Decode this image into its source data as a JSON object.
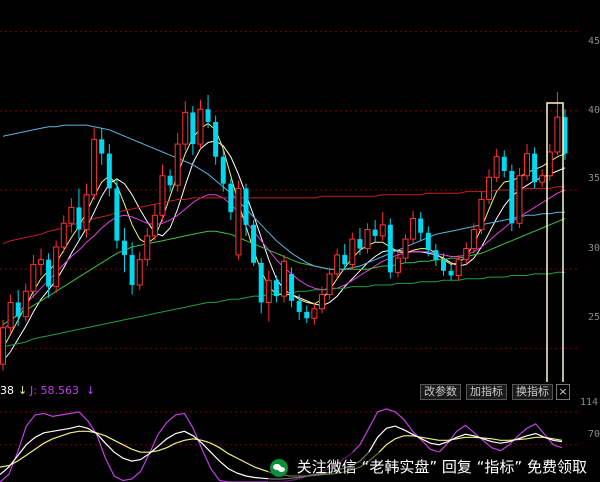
{
  "colors": {
    "up": "#ff3232",
    "down": "#00d8f0",
    "grid": "#8b0000",
    "ma_white": "#ffffff",
    "ma_yellow": "#f0f080",
    "ma_magenta": "#e040e0",
    "ma_lightgreen": "#40c040",
    "ma_skyblue": "#5ab4e0",
    "ma_darkred": "#c02020",
    "ma_green": "#20a040",
    "k_line": "#ffffff",
    "d_line": "#f0f080",
    "j_line": "#c040e0"
  },
  "indicator": {
    "left_value": "38",
    "left_arrow": "↓",
    "j_label": "J: 58.563",
    "j_arrow": "↓",
    "buttons": [
      "改参数",
      "加指标",
      "换指标"
    ],
    "close": "×"
  },
  "axis": {
    "main_ticks": [
      "45",
      "40",
      "35",
      "30",
      "25"
    ],
    "sub_ticks": [
      "114",
      "70"
    ]
  },
  "watermark": {
    "text": "关注微信 “老韩实盘” 回复 “指标” 免费领取"
  },
  "chart_data": {
    "type": "candlestick",
    "price_range": [
      23,
      47
    ],
    "grid": true,
    "candles": [
      {
        "o": 24.0,
        "h": 26.8,
        "l": 23.6,
        "c": 26.3
      },
      {
        "o": 26.3,
        "h": 28.4,
        "l": 25.9,
        "c": 27.9
      },
      {
        "o": 27.9,
        "h": 28.7,
        "l": 26.4,
        "c": 27.0
      },
      {
        "o": 27.0,
        "h": 29.1,
        "l": 26.7,
        "c": 28.6
      },
      {
        "o": 28.6,
        "h": 30.9,
        "l": 28.2,
        "c": 30.3
      },
      {
        "o": 30.3,
        "h": 31.3,
        "l": 29.6,
        "c": 30.6
      },
      {
        "o": 30.6,
        "h": 31.0,
        "l": 28.2,
        "c": 28.9
      },
      {
        "o": 28.9,
        "h": 31.8,
        "l": 28.5,
        "c": 31.4
      },
      {
        "o": 31.4,
        "h": 33.4,
        "l": 31.0,
        "c": 32.9
      },
      {
        "o": 32.9,
        "h": 34.5,
        "l": 32.3,
        "c": 33.9
      },
      {
        "o": 33.9,
        "h": 35.1,
        "l": 31.9,
        "c": 32.5
      },
      {
        "o": 32.5,
        "h": 35.4,
        "l": 32.0,
        "c": 34.7
      },
      {
        "o": 34.7,
        "h": 38.9,
        "l": 34.4,
        "c": 38.2
      },
      {
        "o": 38.2,
        "h": 38.9,
        "l": 36.6,
        "c": 37.3
      },
      {
        "o": 37.3,
        "h": 37.9,
        "l": 34.6,
        "c": 35.1
      },
      {
        "o": 35.1,
        "h": 35.7,
        "l": 31.3,
        "c": 31.8
      },
      {
        "o": 31.8,
        "h": 32.6,
        "l": 29.8,
        "c": 30.9
      },
      {
        "o": 30.9,
        "h": 31.7,
        "l": 28.4,
        "c": 29.0
      },
      {
        "o": 29.0,
        "h": 31.1,
        "l": 28.7,
        "c": 30.6
      },
      {
        "o": 30.6,
        "h": 32.6,
        "l": 30.2,
        "c": 32.1
      },
      {
        "o": 32.1,
        "h": 34.1,
        "l": 31.8,
        "c": 33.4
      },
      {
        "o": 33.4,
        "h": 36.6,
        "l": 33.0,
        "c": 35.9
      },
      {
        "o": 35.9,
        "h": 36.3,
        "l": 34.9,
        "c": 35.3
      },
      {
        "o": 35.3,
        "h": 38.6,
        "l": 34.9,
        "c": 37.9
      },
      {
        "o": 37.9,
        "h": 40.6,
        "l": 37.5,
        "c": 39.9
      },
      {
        "o": 39.9,
        "h": 40.3,
        "l": 37.2,
        "c": 37.9
      },
      {
        "o": 37.9,
        "h": 40.7,
        "l": 37.6,
        "c": 40.1
      },
      {
        "o": 40.1,
        "h": 41.0,
        "l": 38.9,
        "c": 39.3
      },
      {
        "o": 39.3,
        "h": 39.7,
        "l": 36.6,
        "c": 37.1
      },
      {
        "o": 37.1,
        "h": 37.6,
        "l": 34.9,
        "c": 35.4
      },
      {
        "o": 35.4,
        "h": 35.7,
        "l": 33.1,
        "c": 33.6
      },
      {
        "o": 30.9,
        "h": 35.6,
        "l": 30.6,
        "c": 35.1
      },
      {
        "o": 35.1,
        "h": 35.4,
        "l": 32.1,
        "c": 32.8
      },
      {
        "o": 32.8,
        "h": 33.1,
        "l": 30.2,
        "c": 30.4
      },
      {
        "o": 30.4,
        "h": 30.7,
        "l": 27.2,
        "c": 27.9
      },
      {
        "o": 27.9,
        "h": 29.9,
        "l": 26.7,
        "c": 29.3
      },
      {
        "o": 29.3,
        "h": 29.6,
        "l": 27.9,
        "c": 28.3
      },
      {
        "o": 28.3,
        "h": 30.9,
        "l": 27.9,
        "c": 30.5
      },
      {
        "o": 29.7,
        "h": 30.1,
        "l": 27.6,
        "c": 28.0
      },
      {
        "o": 28.0,
        "h": 28.4,
        "l": 26.8,
        "c": 27.3
      },
      {
        "o": 27.3,
        "h": 27.7,
        "l": 26.6,
        "c": 26.9
      },
      {
        "o": 26.9,
        "h": 27.9,
        "l": 26.5,
        "c": 27.5
      },
      {
        "o": 27.5,
        "h": 28.9,
        "l": 27.2,
        "c": 28.4
      },
      {
        "o": 28.4,
        "h": 30.1,
        "l": 28.1,
        "c": 29.7
      },
      {
        "o": 29.7,
        "h": 31.3,
        "l": 29.4,
        "c": 30.9
      },
      {
        "o": 30.9,
        "h": 31.6,
        "l": 30.0,
        "c": 30.3
      },
      {
        "o": 30.3,
        "h": 32.3,
        "l": 30.0,
        "c": 31.9
      },
      {
        "o": 31.9,
        "h": 32.6,
        "l": 30.9,
        "c": 31.3
      },
      {
        "o": 31.3,
        "h": 32.9,
        "l": 31.0,
        "c": 32.5
      },
      {
        "o": 32.5,
        "h": 33.1,
        "l": 31.7,
        "c": 32.1
      },
      {
        "o": 32.1,
        "h": 33.6,
        "l": 31.8,
        "c": 32.8
      },
      {
        "o": 32.8,
        "h": 33.2,
        "l": 29.4,
        "c": 29.8
      },
      {
        "o": 29.8,
        "h": 31.1,
        "l": 29.5,
        "c": 30.7
      },
      {
        "o": 30.7,
        "h": 32.2,
        "l": 30.4,
        "c": 31.9
      },
      {
        "o": 31.9,
        "h": 33.7,
        "l": 31.6,
        "c": 33.2
      },
      {
        "o": 33.2,
        "h": 33.6,
        "l": 31.8,
        "c": 32.3
      },
      {
        "o": 32.3,
        "h": 32.7,
        "l": 30.8,
        "c": 31.2
      },
      {
        "o": 31.2,
        "h": 31.6,
        "l": 30.2,
        "c": 30.6
      },
      {
        "o": 30.6,
        "h": 31.0,
        "l": 29.6,
        "c": 29.9
      },
      {
        "o": 29.9,
        "h": 30.3,
        "l": 29.3,
        "c": 29.6
      },
      {
        "o": 29.6,
        "h": 30.9,
        "l": 29.3,
        "c": 30.6
      },
      {
        "o": 30.6,
        "h": 31.7,
        "l": 30.3,
        "c": 31.3
      },
      {
        "o": 31.3,
        "h": 32.9,
        "l": 31.0,
        "c": 32.5
      },
      {
        "o": 32.5,
        "h": 34.9,
        "l": 32.2,
        "c": 34.4
      },
      {
        "o": 34.4,
        "h": 36.3,
        "l": 34.1,
        "c": 35.8
      },
      {
        "o": 35.8,
        "h": 37.6,
        "l": 35.5,
        "c": 37.1
      },
      {
        "o": 37.1,
        "h": 37.5,
        "l": 35.8,
        "c": 36.2
      },
      {
        "o": 36.2,
        "h": 36.6,
        "l": 32.4,
        "c": 32.9
      },
      {
        "o": 32.9,
        "h": 36.4,
        "l": 32.6,
        "c": 35.9
      },
      {
        "o": 35.9,
        "h": 37.9,
        "l": 35.6,
        "c": 37.3
      },
      {
        "o": 37.3,
        "h": 37.7,
        "l": 35.1,
        "c": 35.5
      },
      {
        "o": 35.5,
        "h": 36.3,
        "l": 35.2,
        "c": 35.9
      },
      {
        "o": 35.9,
        "h": 37.9,
        "l": 35.6,
        "c": 37.4
      },
      {
        "o": 37.4,
        "h": 41.2,
        "l": 37.2,
        "c": 39.6
      },
      {
        "o": 39.6,
        "h": 40.1,
        "l": 36.9,
        "c": 37.3
      }
    ],
    "moving_averages": [
      {
        "color": "#ffffff",
        "values": [
          24.2,
          24.8,
          25.6,
          26.4,
          27.3,
          28.1,
          28.7,
          29.3,
          30.1,
          31.0,
          31.8,
          32.6,
          33.6,
          34.6,
          35.4,
          35.7,
          35.4,
          34.7,
          33.8,
          33.0,
          32.3,
          32.1,
          32.6,
          33.8,
          35.3,
          36.7,
          37.6,
          38.0,
          38.1,
          37.8,
          37.1,
          36.0,
          34.7,
          33.4,
          32.0,
          30.6,
          29.4,
          28.7,
          28.4,
          28.2,
          28.0,
          27.8,
          27.7,
          27.9,
          28.3,
          28.9,
          29.4,
          29.9,
          30.4,
          30.8,
          31.1,
          31.2,
          31.2,
          31.1,
          31.1,
          31.1,
          31.0,
          30.9,
          30.7,
          30.4,
          30.2,
          30.3,
          30.7,
          31.4,
          32.3,
          33.2,
          34.0,
          34.6,
          35.0,
          35.3,
          35.6,
          35.8,
          36.0,
          36.2,
          36.4
        ]
      },
      {
        "color": "#f0f080",
        "values": [
          25.0,
          25.9,
          26.8,
          27.7,
          28.6,
          29.4,
          29.9,
          30.4,
          31.2,
          32.0,
          32.7,
          33.6,
          34.6,
          35.5,
          35.9,
          35.3,
          34.1,
          32.8,
          31.9,
          31.6,
          32.0,
          33.2,
          34.6,
          36.0,
          37.3,
          38.3,
          38.9,
          39.2,
          38.8,
          37.6,
          35.9,
          34.2,
          32.7,
          31.2,
          29.9,
          28.9,
          28.4,
          28.4,
          28.4,
          28.1,
          27.9,
          27.8,
          28.1,
          28.7,
          29.4,
          30.1,
          30.7,
          31.2,
          31.5,
          31.7,
          31.7,
          31.4,
          31.1,
          31.0,
          31.2,
          31.3,
          31.3,
          31.0,
          30.6,
          30.3,
          30.4,
          30.8,
          31.6,
          32.6,
          33.8,
          34.9,
          35.5,
          35.6,
          35.8,
          36.1,
          36.3,
          36.5,
          36.8,
          37.1,
          37.3
        ]
      },
      {
        "color": "#e040e0",
        "values": [
          26.1,
          26.7,
          27.2,
          27.8,
          28.3,
          28.8,
          29.3,
          29.8,
          30.3,
          30.8,
          31.2,
          31.7,
          32.1,
          32.6,
          33.0,
          33.3,
          33.4,
          33.3,
          33.1,
          32.9,
          32.8,
          32.9,
          33.1,
          33.4,
          33.8,
          34.2,
          34.5,
          34.7,
          34.7,
          34.5,
          34.1,
          33.6,
          33.0,
          32.4,
          31.8,
          31.2,
          30.6,
          30.1,
          29.7,
          29.3,
          29.0,
          28.8,
          28.7,
          28.7,
          28.8,
          29.0,
          29.3,
          29.6,
          29.9,
          30.2,
          30.5,
          30.7,
          30.9,
          31.0,
          31.1,
          31.1,
          31.1,
          31.0,
          30.9,
          30.8,
          30.8,
          30.9,
          31.1,
          31.4,
          31.8,
          32.2,
          32.6,
          33.0,
          33.3,
          33.6,
          33.9,
          34.2,
          34.5,
          34.8,
          35.0
        ]
      },
      {
        "color": "#40c040",
        "values": [
          26.5,
          26.8,
          27.1,
          27.4,
          27.7,
          28.0,
          28.3,
          28.6,
          28.9,
          29.2,
          29.5,
          29.8,
          30.1,
          30.4,
          30.7,
          31.0,
          31.2,
          31.4,
          31.5,
          31.6,
          31.7,
          31.8,
          31.9,
          32.0,
          32.1,
          32.2,
          32.3,
          32.4,
          32.4,
          32.3,
          32.2,
          32.0,
          31.8,
          31.6,
          31.4,
          31.2,
          31.0,
          30.8,
          30.6,
          30.4,
          30.3,
          30.2,
          30.1,
          30.0,
          30.0,
          30.0,
          30.0,
          30.0,
          30.0,
          30.1,
          30.2,
          30.2,
          30.3,
          30.4,
          30.4,
          30.5,
          30.5,
          30.6,
          30.6,
          30.7,
          30.7,
          30.8,
          30.9,
          31.0,
          31.2,
          31.4,
          31.6,
          31.8,
          32.0,
          32.2,
          32.4,
          32.6,
          32.8,
          33.0,
          33.2
        ]
      },
      {
        "color": "#5ab4e0",
        "values": [
          38.4,
          38.5,
          38.6,
          38.7,
          38.8,
          38.9,
          39.0,
          39.0,
          39.1,
          39.1,
          39.1,
          39.1,
          39.0,
          38.9,
          38.8,
          38.6,
          38.4,
          38.2,
          38.0,
          37.8,
          37.6,
          37.4,
          37.2,
          37.0,
          36.8,
          36.6,
          36.3,
          36.0,
          35.6,
          35.2,
          34.8,
          34.3,
          33.8,
          33.3,
          32.8,
          32.3,
          31.8,
          31.4,
          31.0,
          30.7,
          30.4,
          30.2,
          30.1,
          30.0,
          30.0,
          30.0,
          30.1,
          30.2,
          30.4,
          30.6,
          30.8,
          31.0,
          31.2,
          31.4,
          31.6,
          31.8,
          32.0,
          32.2,
          32.3,
          32.4,
          32.5,
          32.6,
          32.7,
          32.8,
          32.9,
          33.0,
          33.1,
          33.2,
          33.3,
          33.4,
          33.4,
          33.5,
          33.5,
          33.6,
          33.6
        ]
      },
      {
        "color": "#c02020",
        "values": [
          31.6,
          31.8,
          31.9,
          32.0,
          32.1,
          32.2,
          32.4,
          32.5,
          32.6,
          32.8,
          32.9,
          33.0,
          33.2,
          33.3,
          33.4,
          33.6,
          33.7,
          33.8,
          33.9,
          34.0,
          34.1,
          34.2,
          34.3,
          34.4,
          34.4,
          34.5,
          34.5,
          34.5,
          34.5,
          34.5,
          34.5,
          34.5,
          34.5,
          34.5,
          34.5,
          34.5,
          34.5,
          34.5,
          34.5,
          34.5,
          34.5,
          34.5,
          34.6,
          34.6,
          34.6,
          34.6,
          34.6,
          34.6,
          34.6,
          34.6,
          34.7,
          34.7,
          34.7,
          34.7,
          34.7,
          34.7,
          34.8,
          34.8,
          34.8,
          34.8,
          34.8,
          34.9,
          34.9,
          34.9,
          34.9,
          35.0,
          35.0,
          35.0,
          35.0,
          35.1,
          35.1,
          35.1,
          35.1,
          35.2,
          35.2
        ]
      },
      {
        "color": "#20a040",
        "values": [
          25.1,
          25.2,
          25.3,
          25.4,
          25.6,
          25.7,
          25.8,
          25.9,
          26.0,
          26.1,
          26.2,
          26.3,
          26.4,
          26.5,
          26.6,
          26.7,
          26.8,
          26.9,
          27.0,
          27.1,
          27.2,
          27.3,
          27.4,
          27.5,
          27.6,
          27.7,
          27.8,
          27.9,
          27.9,
          28.0,
          28.1,
          28.1,
          28.2,
          28.3,
          28.3,
          28.4,
          28.4,
          28.5,
          28.5,
          28.6,
          28.6,
          28.7,
          28.7,
          28.8,
          28.8,
          28.8,
          28.9,
          28.9,
          28.9,
          29.0,
          29.0,
          29.0,
          29.1,
          29.1,
          29.1,
          29.2,
          29.2,
          29.2,
          29.3,
          29.3,
          29.3,
          29.4,
          29.4,
          29.4,
          29.5,
          29.5,
          29.5,
          29.6,
          29.6,
          29.6,
          29.7,
          29.7,
          29.7,
          29.8,
          29.8
        ]
      }
    ],
    "kdj": {
      "range": [
        20,
        130
      ],
      "k": [
        30,
        40,
        55,
        70,
        80,
        86,
        88,
        90,
        92,
        95,
        92,
        85,
        72,
        60,
        52,
        48,
        50,
        58,
        68,
        78,
        85,
        88,
        82,
        72,
        60,
        48,
        38,
        32,
        28,
        26,
        25,
        24,
        24,
        25,
        26,
        28,
        30,
        32,
        34,
        38,
        42,
        48,
        60,
        80,
        92,
        95,
        90,
        84,
        78,
        72,
        70,
        74,
        80,
        84,
        82,
        78,
        74,
        72,
        74,
        78,
        82,
        85,
        80,
        76,
        74
      ],
      "d": [
        40,
        42,
        48,
        56,
        64,
        72,
        78,
        82,
        86,
        88,
        88,
        86,
        82,
        76,
        70,
        64,
        60,
        60,
        62,
        66,
        72,
        76,
        78,
        76,
        72,
        66,
        58,
        52,
        46,
        40,
        36,
        32,
        30,
        28,
        28,
        28,
        29,
        30,
        31,
        33,
        36,
        40,
        48,
        58,
        70,
        78,
        82,
        82,
        80,
        78,
        76,
        76,
        78,
        80,
        80,
        79,
        78,
        76,
        76,
        77,
        78,
        80,
        80,
        78,
        76
      ],
      "j": [
        20,
        30,
        60,
        95,
        110,
        112,
        108,
        110,
        112,
        114,
        102,
        84,
        52,
        28,
        22,
        24,
        34,
        58,
        84,
        100,
        110,
        112,
        92,
        64,
        38,
        22,
        20,
        20,
        20,
        20,
        20,
        20,
        20,
        22,
        24,
        28,
        32,
        36,
        40,
        50,
        58,
        70,
        92,
        114,
        118,
        114,
        104,
        88,
        76,
        64,
        60,
        72,
        88,
        96,
        86,
        76,
        66,
        62,
        70,
        82,
        92,
        98,
        84,
        70,
        66
      ]
    }
  }
}
